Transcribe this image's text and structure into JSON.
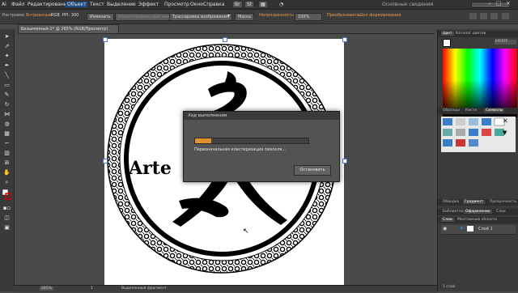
{
  "menubar": {
    "items": [
      "Файл",
      "Редактирование",
      "Объект",
      "Текст",
      "Выделение",
      "Эффект",
      "Просмотр",
      "Окно",
      "Справка"
    ],
    "active_index": 2,
    "workspace": "Основные сведения"
  },
  "control_bar": {
    "selection_label": "Растровое",
    "embedded_label": "Встроенные",
    "color_mode": "RGB",
    "ppi": "PPI: 300",
    "edit_button": "Изменить",
    "edit_original": "Редактировать оригинал",
    "trace_preset": "Трассировка изображения",
    "mask_button": "Маска",
    "opacity_label": "Непрозрачность",
    "opacity_value": "100%",
    "transform_label": "Преобразовать",
    "pointer_label": "Шел формирования"
  },
  "document": {
    "tab_title": "Безымянный-1* @ 265% (RGB/Просмотр)"
  },
  "dialog": {
    "title": "Ход выполнения",
    "progress_fraction": 0.14,
    "status": "Первоначальная кластеризация пикселя...",
    "stop_button": "Остановить"
  },
  "right_panel": {
    "top_tabs": [
      "Цвет",
      "Каталог цветов"
    ],
    "swatch_tabs": [
      "Образцы",
      "Кисти",
      "Символы"
    ],
    "mid_tabs": [
      "Обводка",
      "Градиент",
      "Прозрачность"
    ],
    "lower_tabs": [
      "Библиотеки",
      "Оформление",
      "Слои"
    ],
    "layers_tabs": [
      "Слои",
      "Монтажные области"
    ],
    "layer_name": "Слой 1",
    "layers_count": "1 слой",
    "fill_hex": "FFFFFF"
  },
  "status_bar": {
    "zoom": "265%",
    "page": "1",
    "tool_label": "Выделенный фрагмент"
  },
  "artwork": {
    "visible_text": "Arte"
  }
}
